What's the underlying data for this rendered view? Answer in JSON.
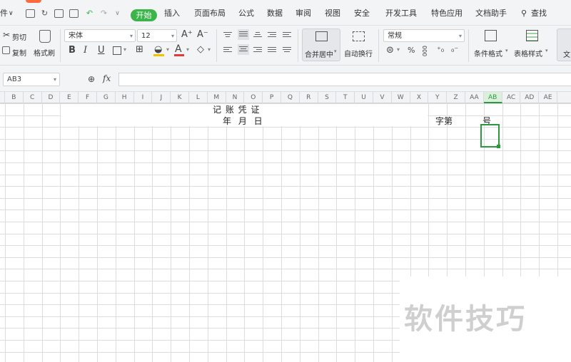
{
  "menubar": {
    "file_label": "件",
    "file_chevron": "∨",
    "quick_icons": [
      "save-icon",
      "redo-icon",
      "print-icon",
      "preview-icon",
      "undo-icon",
      "redo-arrow-icon",
      "chevron-down-icon"
    ],
    "tabs": [
      "开始",
      "插入",
      "页面布局",
      "公式",
      "数据",
      "审阅",
      "视图",
      "安全",
      "开发工具",
      "特色应用",
      "文档助手"
    ],
    "active_tab": "开始",
    "search_label": "查找",
    "accent_color": "#3bb54a"
  },
  "ribbon": {
    "clipboard": {
      "cut": "剪切",
      "copy": "复制",
      "format_painter": "格式刷"
    },
    "font": {
      "family": "宋体",
      "size": "12",
      "grow": "A⁺",
      "shrink": "A⁻",
      "bold": "B",
      "italic": "I",
      "underline": "U"
    },
    "alignment": {
      "merge_center": "合并居中",
      "wrap_text": "自动换行"
    },
    "number": {
      "format": "常规",
      "percent": "%",
      "thousands": "000"
    },
    "styles": {
      "conditional_format": "条件格式",
      "table_style": "表格样式",
      "cut_off": "文"
    }
  },
  "formula_bar": {
    "name_box": "AB3",
    "fx": "fx",
    "formula": ""
  },
  "grid": {
    "columns": [
      "B",
      "C",
      "D",
      "E",
      "F",
      "G",
      "H",
      "I",
      "J",
      "K",
      "L",
      "M",
      "N",
      "O",
      "P",
      "Q",
      "R",
      "S",
      "T",
      "U",
      "V",
      "W",
      "X",
      "Y",
      "Z",
      "AA",
      "AB",
      "AC",
      "AD",
      "AE"
    ],
    "selected_column": "AB",
    "title": "记 账 凭 证",
    "date_line": "年 月 日",
    "number_label": "字第",
    "number_suffix": "号"
  },
  "watermark": "软件技巧"
}
